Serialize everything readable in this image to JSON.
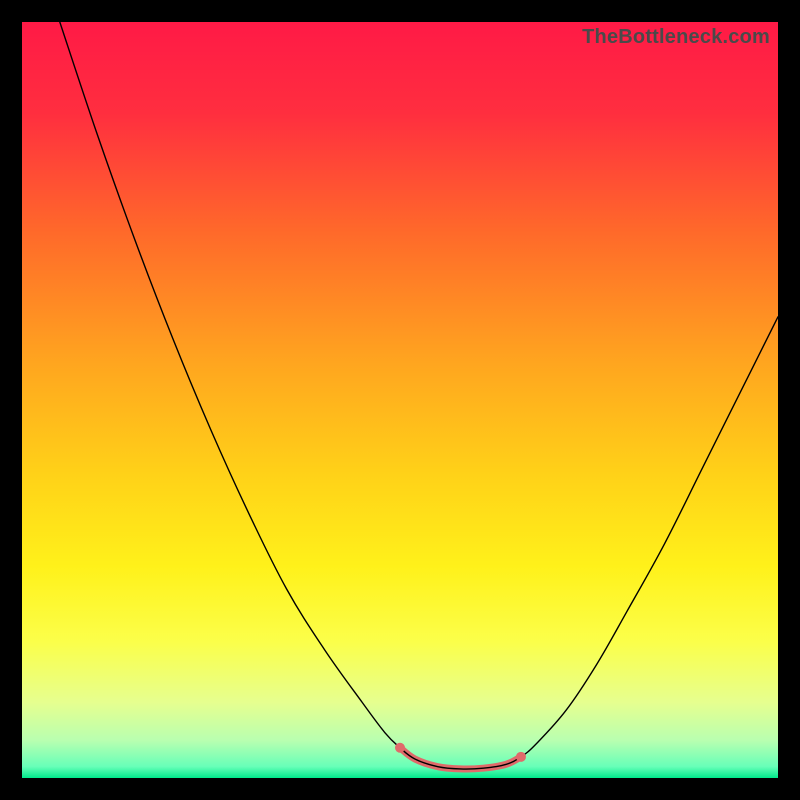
{
  "watermark": "TheBottleneck.com",
  "chart_data": {
    "type": "line",
    "title": "",
    "xlabel": "",
    "ylabel": "",
    "xlim": [
      0,
      100
    ],
    "ylim": [
      0,
      100
    ],
    "gradient_stops": [
      {
        "offset": 0.0,
        "color": "#ff1a46"
      },
      {
        "offset": 0.12,
        "color": "#ff2e3f"
      },
      {
        "offset": 0.28,
        "color": "#ff6a2a"
      },
      {
        "offset": 0.45,
        "color": "#ffa51f"
      },
      {
        "offset": 0.6,
        "color": "#ffd218"
      },
      {
        "offset": 0.72,
        "color": "#fff11a"
      },
      {
        "offset": 0.82,
        "color": "#fbff4a"
      },
      {
        "offset": 0.9,
        "color": "#e6ff8f"
      },
      {
        "offset": 0.95,
        "color": "#b9ffb0"
      },
      {
        "offset": 0.985,
        "color": "#67ffb8"
      },
      {
        "offset": 1.0,
        "color": "#00e98b"
      }
    ],
    "series": [
      {
        "name": "curve",
        "stroke": "#000000",
        "stroke_width": 1.4,
        "points": [
          {
            "x": 5.0,
            "y": 100.0
          },
          {
            "x": 10.0,
            "y": 85.0
          },
          {
            "x": 15.0,
            "y": 71.0
          },
          {
            "x": 20.0,
            "y": 58.0
          },
          {
            "x": 25.0,
            "y": 46.0
          },
          {
            "x": 30.0,
            "y": 35.0
          },
          {
            "x": 35.0,
            "y": 25.0
          },
          {
            "x": 40.0,
            "y": 17.0
          },
          {
            "x": 45.0,
            "y": 10.0
          },
          {
            "x": 48.0,
            "y": 6.0
          },
          {
            "x": 50.0,
            "y": 4.0
          },
          {
            "x": 52.0,
            "y": 2.5
          },
          {
            "x": 55.0,
            "y": 1.5
          },
          {
            "x": 58.0,
            "y": 1.2
          },
          {
            "x": 61.0,
            "y": 1.3
          },
          {
            "x": 64.0,
            "y": 1.8
          },
          {
            "x": 66.0,
            "y": 2.8
          },
          {
            "x": 68.0,
            "y": 4.5
          },
          {
            "x": 72.0,
            "y": 9.0
          },
          {
            "x": 76.0,
            "y": 15.0
          },
          {
            "x": 80.0,
            "y": 22.0
          },
          {
            "x": 85.0,
            "y": 31.0
          },
          {
            "x": 90.0,
            "y": 41.0
          },
          {
            "x": 95.0,
            "y": 51.0
          },
          {
            "x": 100.0,
            "y": 61.0
          }
        ]
      },
      {
        "name": "highlight",
        "stroke": "#e06a6a",
        "stroke_width": 7,
        "points": [
          {
            "x": 50.0,
            "y": 4.0
          },
          {
            "x": 52.0,
            "y": 2.5
          },
          {
            "x": 55.0,
            "y": 1.5
          },
          {
            "x": 58.0,
            "y": 1.2
          },
          {
            "x": 61.0,
            "y": 1.3
          },
          {
            "x": 64.0,
            "y": 1.8
          },
          {
            "x": 66.0,
            "y": 2.8
          }
        ]
      }
    ],
    "endpoint_dots": {
      "color": "#e06a6a",
      "radius": 5,
      "points": [
        {
          "x": 50.0,
          "y": 4.0
        },
        {
          "x": 66.0,
          "y": 2.8
        }
      ]
    }
  }
}
